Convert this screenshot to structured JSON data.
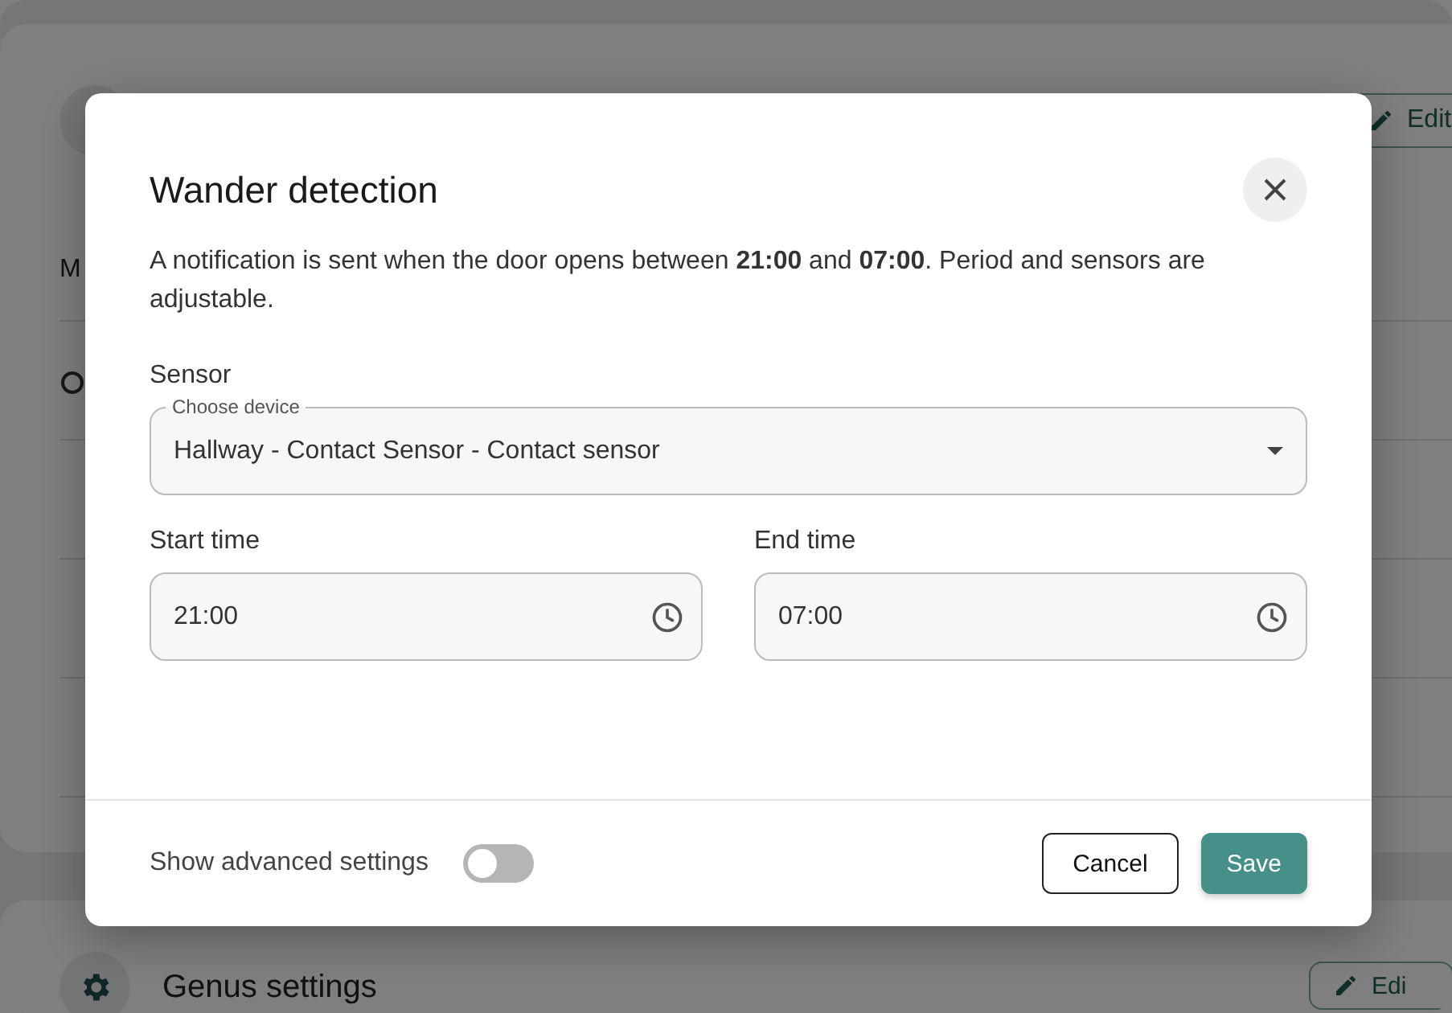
{
  "background": {
    "edit_button": "Edit",
    "row_label": "M",
    "section_title": "Genus settings",
    "section_edit_button": "Edi"
  },
  "dialog": {
    "title": "Wander detection",
    "description": "A notification is sent when the door opens between **21:00** and **07:00**. Period and sensors are adjustable.",
    "sensor": {
      "label": "Sensor",
      "floating_label": "Choose device",
      "value": "Hallway - Contact Sensor - Contact sensor"
    },
    "times": [
      {
        "label": "Start time",
        "value": "21:00"
      },
      {
        "label": "End time",
        "value": "07:00"
      }
    ],
    "advanced": {
      "label": "Show advanced settings",
      "on": false
    },
    "buttons": [
      {
        "kind": "secondary",
        "label": "Cancel"
      },
      {
        "kind": "primary",
        "label": "Save"
      }
    ]
  }
}
